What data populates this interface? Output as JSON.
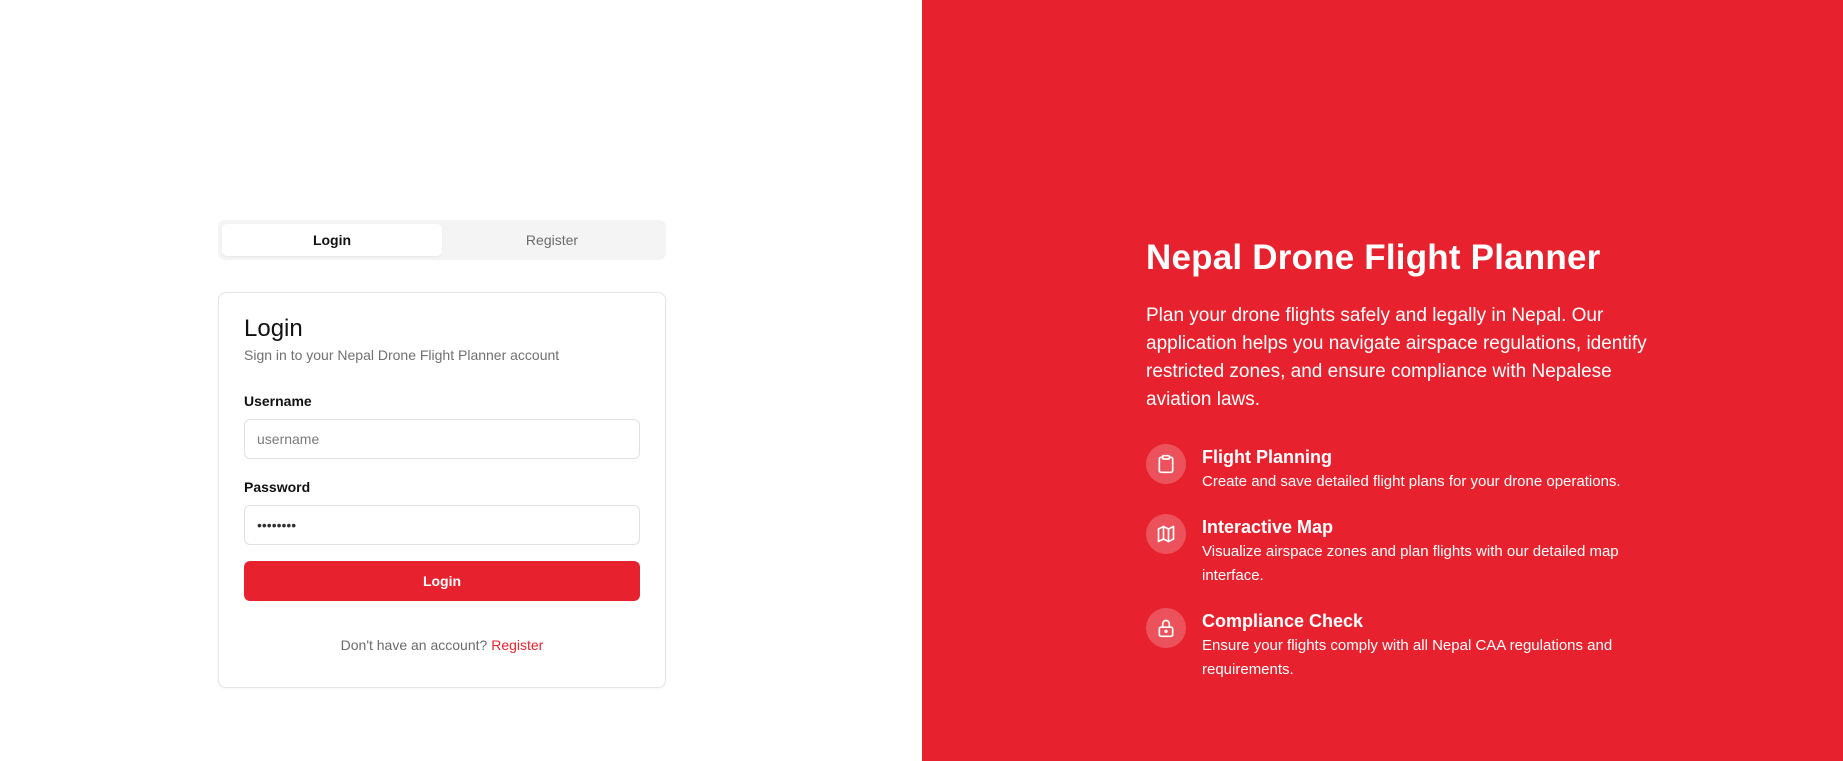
{
  "tabs": {
    "login": "Login",
    "register": "Register"
  },
  "card": {
    "title": "Login",
    "subtitle": "Sign in to your Nepal Drone Flight Planner account",
    "username_label": "Username",
    "username_placeholder": "username",
    "username_value": "",
    "password_label": "Password",
    "password_value": "••••••••",
    "submit_label": "Login",
    "switch_prompt": "Don't have an account?",
    "switch_link": "Register"
  },
  "hero": {
    "title": "Nepal Drone Flight Planner",
    "description": "Plan your drone flights safely and legally in Nepal. Our application helps you navigate airspace regulations, identify restricted zones, and ensure compliance with Nepalese aviation laws.",
    "features": [
      {
        "icon": "clipboard-icon",
        "title": "Flight Planning",
        "desc": "Create and save detailed flight plans for your drone operations."
      },
      {
        "icon": "map-icon",
        "title": "Interactive Map",
        "desc": "Visualize airspace zones and plan flights with our detailed map interface."
      },
      {
        "icon": "lock-icon",
        "title": "Compliance Check",
        "desc": "Ensure your flights comply with all Nepal CAA regulations and requirements."
      }
    ]
  },
  "colors": {
    "accent": "#e7222e",
    "panel_bg": "#e7222e",
    "text_muted": "#6b6b6b"
  }
}
